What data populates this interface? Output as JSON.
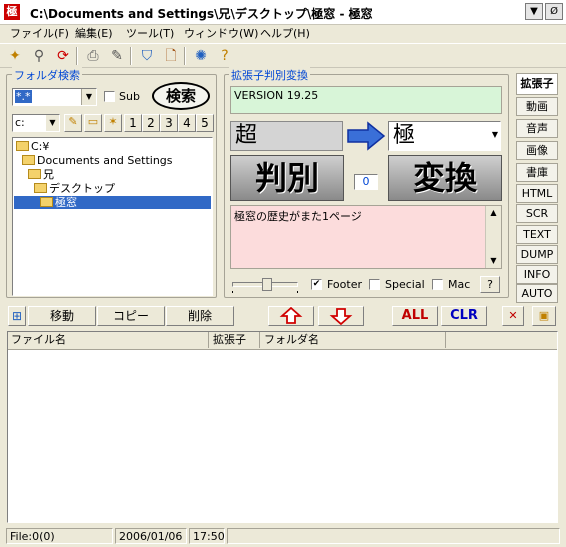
{
  "window": {
    "title": "C:\\Documents and Settings\\兄\\デスクトップ\\極窓 - 極窓",
    "app_icon_text": "極",
    "min_label": "▼",
    "close_label": "Ø"
  },
  "menu": [
    "ファイル(F)",
    "編集(E)",
    "ツール(T)",
    "ウィンドウ(W)",
    "ヘルプ(H)"
  ],
  "toolbar": {
    "icons": [
      "new-icon",
      "find-icon",
      "refresh-icon",
      "print-icon",
      "edit-icon",
      "shield-icon",
      "search-doc-icon",
      "settings-icon",
      "help-icon"
    ]
  },
  "folder_search": {
    "title": "フォルダ検索",
    "pattern_value": "*.*",
    "sub_label": "Sub",
    "search_button": "検索",
    "drive_value": "c:",
    "number_buttons": [
      "1",
      "2",
      "3",
      "4",
      "5"
    ],
    "tree": [
      {
        "label": "C:¥",
        "indent": 0,
        "selected": false
      },
      {
        "label": "Documents and Settings",
        "indent": 1,
        "selected": false
      },
      {
        "label": "兄",
        "indent": 2,
        "selected": false
      },
      {
        "label": "デスクトップ",
        "indent": 3,
        "selected": false
      },
      {
        "label": "極窓",
        "indent": 4,
        "selected": true
      }
    ]
  },
  "ext_convert": {
    "title": "拡張子判別変換",
    "version_text": "VERSION 19.25",
    "source_text": "超",
    "target_value": "極",
    "judge_button": "判別",
    "count_value": "0",
    "convert_button": "変換",
    "memo_text": "極窓の歴史がまた1ページ",
    "footer_label": "Footer",
    "footer_checked": true,
    "special_label": "Special",
    "special_checked": false,
    "mac_label": "Mac",
    "mac_checked": false,
    "help_button": "?"
  },
  "side_tabs": [
    "拡張子",
    "動画",
    "音声",
    "画像",
    "書庫",
    "HTML",
    "SCR",
    "TEXT",
    "DUMP",
    "INFO",
    "AUTO"
  ],
  "actions": {
    "move_button": "移動",
    "copy_button": "コピー",
    "delete_button": "削除",
    "all_button": "ALL",
    "clr_button": "CLR"
  },
  "file_list": {
    "columns": [
      "ファイル名",
      "拡張子",
      "フォルダ名"
    ],
    "rows": []
  },
  "status": {
    "file_count": "File:0(0)",
    "date": "2006/01/06",
    "time": "17:50"
  },
  "colors": {
    "version_bg": "#d8f5d8",
    "memo_bg": "#fcdcdc",
    "selected_bg": "#3169c6",
    "accent_red": "#c00000",
    "accent_blue": "#0000c0"
  }
}
